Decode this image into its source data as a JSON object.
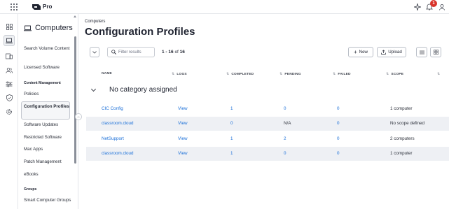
{
  "app": {
    "brand": "Pro",
    "notification_count": "1"
  },
  "sidebar": {
    "title": "Computers",
    "items": [
      {
        "label": "Search Volume Content"
      },
      {
        "label": "Licensed Software"
      },
      {
        "label": "Policies"
      },
      {
        "label": "Configuration Profiles"
      },
      {
        "label": "Software Updates"
      },
      {
        "label": "Restricted Software"
      },
      {
        "label": "Mac Apps"
      },
      {
        "label": "Patch Management"
      },
      {
        "label": "eBooks"
      },
      {
        "label": "Smart Computer Groups"
      }
    ],
    "sections": {
      "content_management": "Content Management",
      "groups": "Groups"
    },
    "active_item": "Configuration Profiles"
  },
  "main": {
    "breadcrumb": "Computers",
    "title": "Configuration Profiles",
    "filter_placeholder": "Filter results",
    "count_range": "1 - 16",
    "count_of": "of",
    "count_total": "16",
    "new_label": "New",
    "upload_label": "Upload",
    "columns": [
      "NAME",
      "LOGS",
      "COMPLETED",
      "PENDING",
      "FAILED",
      "SCOPE"
    ],
    "category": "No category assigned",
    "rows": [
      {
        "name": "CIC Config",
        "logs": "View",
        "completed": "1",
        "pending": "0",
        "failed": "0",
        "scope": "1 computer"
      },
      {
        "name": "classroom.cloud",
        "logs": "View",
        "completed": "0",
        "pending": "N/A",
        "failed": "0",
        "scope": "No scope defined"
      },
      {
        "name": "NetSupport",
        "logs": "View",
        "completed": "1",
        "pending": "2",
        "failed": "0",
        "scope": "2 computers"
      },
      {
        "name": "classroom.cloud",
        "logs": "View",
        "completed": "1",
        "pending": "0",
        "failed": "0",
        "scope": "1 computer"
      }
    ]
  },
  "colors": {
    "accent_link": "#1a6fd8",
    "badge": "#d9342b",
    "row_alt": "#eef0f4"
  },
  "icons": [
    "apps-grid-icon",
    "jamf-logo-icon",
    "sparkle-icon",
    "bell-icon",
    "user-icon",
    "dashboard-icon",
    "computer-icon",
    "devices-icon",
    "users-icon",
    "settings-sliders-icon",
    "shield-icon",
    "gear-icon",
    "search-icon",
    "chevron-down-icon",
    "plus-icon",
    "upload-icon",
    "list-view-icon",
    "grid-view-icon"
  ]
}
